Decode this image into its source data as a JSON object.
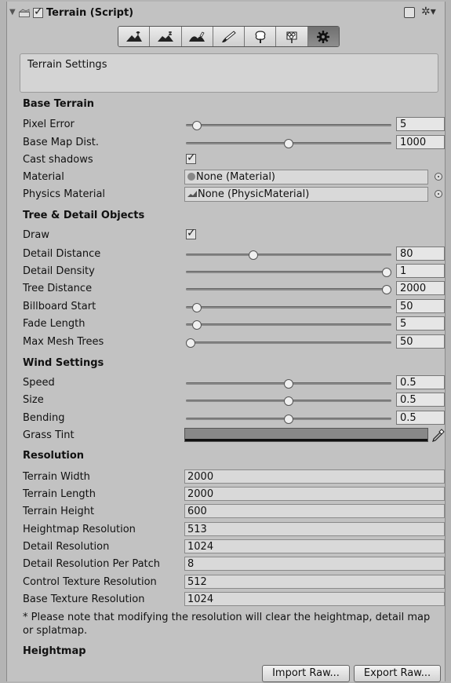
{
  "header": {
    "title": "Terrain (Script)",
    "enabled": true
  },
  "toolbar": {
    "tools": [
      "raise-lower-terrain",
      "paint-height",
      "smooth-height",
      "paint-texture",
      "place-trees",
      "paint-details",
      "terrain-settings"
    ],
    "active_index": 6
  },
  "settings_box": {
    "text": "Terrain Settings"
  },
  "base_terrain": {
    "heading": "Base Terrain",
    "pixel_error": {
      "label": "Pixel Error",
      "value": "5",
      "fill": 0.03
    },
    "base_map_dist": {
      "label": "Base Map Dist.",
      "value": "1000",
      "fill": 0.5
    },
    "cast_shadows": {
      "label": "Cast shadows",
      "checked": true
    },
    "material": {
      "label": "Material",
      "value": "None (Material)"
    },
    "physics_material": {
      "label": "Physics Material",
      "value": "None (PhysicMaterial)"
    }
  },
  "tree_detail": {
    "heading": "Tree & Detail Objects",
    "draw": {
      "label": "Draw",
      "checked": true
    },
    "detail_distance": {
      "label": "Detail Distance",
      "value": "80",
      "fill": 0.32
    },
    "detail_density": {
      "label": "Detail Density",
      "value": "1",
      "fill": 1.0
    },
    "tree_distance": {
      "label": "Tree Distance",
      "value": "2000",
      "fill": 1.0
    },
    "billboard_start": {
      "label": "Billboard Start",
      "value": "50",
      "fill": 0.03
    },
    "fade_length": {
      "label": "Fade Length",
      "value": "5",
      "fill": 0.03
    },
    "max_mesh_trees": {
      "label": "Max Mesh Trees",
      "value": "50",
      "fill": 0.0
    }
  },
  "wind": {
    "heading": "Wind Settings",
    "speed": {
      "label": "Speed",
      "value": "0.5",
      "fill": 0.5
    },
    "size": {
      "label": "Size",
      "value": "0.5",
      "fill": 0.5
    },
    "bending": {
      "label": "Bending",
      "value": "0.5",
      "fill": 0.5
    },
    "grass_tint": {
      "label": "Grass Tint",
      "color": "#888888"
    }
  },
  "resolution": {
    "heading": "Resolution",
    "fields": [
      {
        "label": "Terrain Width",
        "value": "2000"
      },
      {
        "label": "Terrain Length",
        "value": "2000"
      },
      {
        "label": "Terrain Height",
        "value": "600"
      },
      {
        "label": "Heightmap Resolution",
        "value": "513"
      },
      {
        "label": "Detail Resolution",
        "value": "1024"
      },
      {
        "label": "Detail Resolution Per Patch",
        "value": "8"
      },
      {
        "label": "Control Texture Resolution",
        "value": "512"
      },
      {
        "label": "Base Texture Resolution",
        "value": "1024"
      }
    ],
    "note": "* Please note that modifying the resolution will clear the heightmap, detail map or splatmap."
  },
  "heightmap": {
    "heading": "Heightmap",
    "import_label": "Import Raw...",
    "export_label": "Export Raw..."
  }
}
